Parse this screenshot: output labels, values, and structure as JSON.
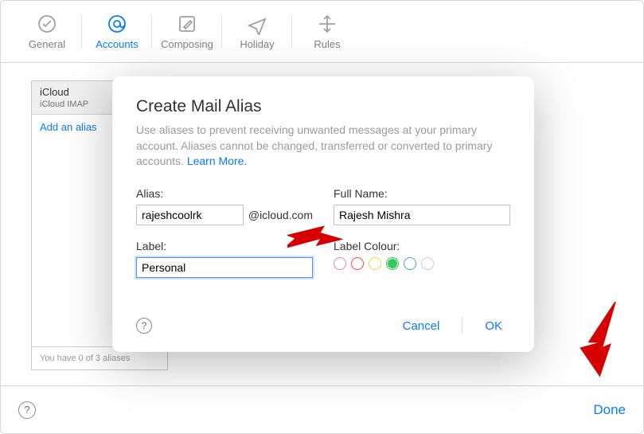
{
  "tabs": {
    "general": "General",
    "accounts": "Accounts",
    "composing": "Composing",
    "holiday": "Holiday",
    "rules": "Rules"
  },
  "sidebar": {
    "account_name": "iCloud",
    "account_type": "iCloud IMAP",
    "add_link": "Add an alias",
    "footer": "You have 0 of 3 aliases"
  },
  "modal": {
    "title": "Create Mail Alias",
    "desc": "Use aliases to prevent receiving unwanted messages at your primary account. Aliases cannot be changed, transferred or converted to primary accounts. ",
    "learn_more": "Learn More.",
    "alias_label": "Alias:",
    "alias_value": "rajeshcoolrk",
    "alias_suffix": "@icloud.com",
    "fullname_label": "Full Name:",
    "fullname_value": "Rajesh Mishra",
    "label_label": "Label:",
    "label_value": "Personal",
    "labelcolor_label": "Label Colour:",
    "colors": [
      "#e87ad0",
      "#ff4a3d",
      "#ffcf3f",
      "#34c759",
      "#34aadc",
      "#c7c7cc"
    ],
    "color_selected": 3,
    "help": "?",
    "cancel": "Cancel",
    "ok": "OK"
  },
  "footer": {
    "help": "?",
    "done": "Done"
  }
}
